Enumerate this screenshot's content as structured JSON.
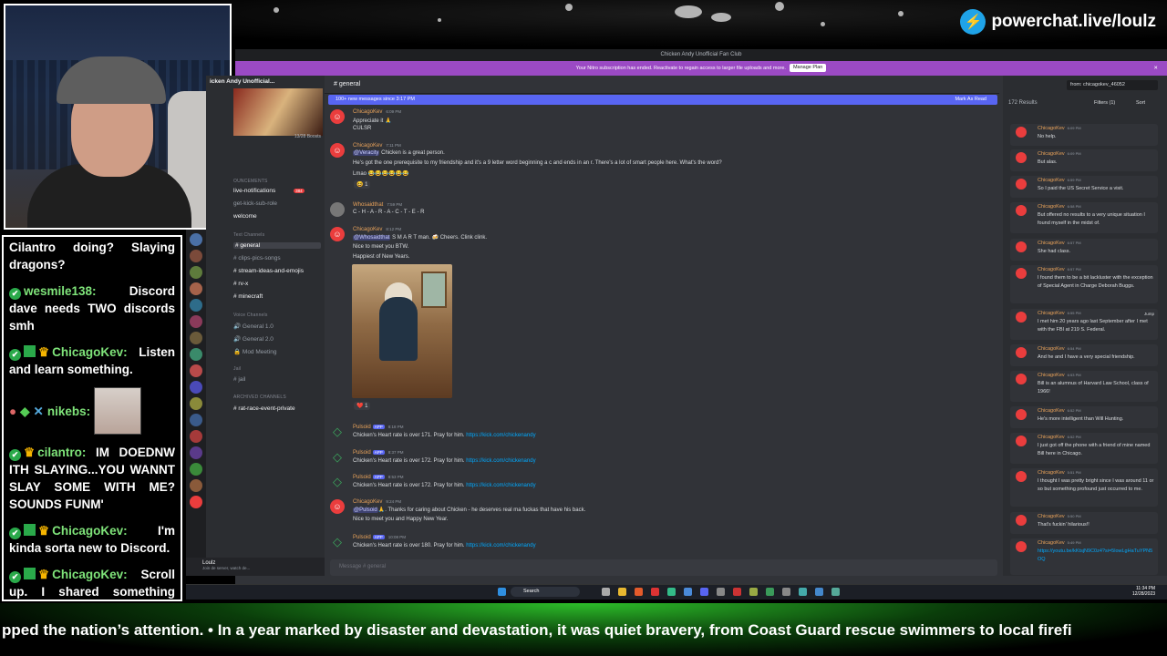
{
  "overlay": {
    "brand": "powerchat.live/loulz",
    "ticker": "pped the nation’s attention.   •   In a year marked by disaster and devastation, it was quiet bravery, from Coast Guard rescue swimmers to local firefi",
    "chat": [
      {
        "user": "",
        "text": "Cilantro doing? Slaying dragons?"
      },
      {
        "user": "wesmile138:",
        "text": "Discord dave needs TWO discords smh"
      },
      {
        "user": "ChicagoKev:",
        "text": "Listen and learn something."
      },
      {
        "user": "nikebs:",
        "text": ""
      },
      {
        "user": "cilantro:",
        "text": "IM DOEDNW ITH SLAYING...YOU WANNT SLAY SOME WITH ME? SOUNDS FUNM'"
      },
      {
        "user": "ChicagoKev:",
        "text": "I'm kinda sorta new to Discord."
      },
      {
        "user": "ChicagoKev:",
        "text": "Scroll up. I shared something valuable. Find the gold"
      }
    ]
  },
  "discord": {
    "window_title": "Chicken Andy Unofficial Fan Club",
    "nitro_notice": "Your Nitro subscription has ended. Reactivate to regain access to larger file uploads and more.",
    "nitro_button": "Manage Plan",
    "server_name": "icken Andy Unofficial...",
    "boosts": "13/28 Boosts",
    "channels": {
      "announcements_cat": "OUNCEMENTS",
      "live_notifications": "live-notifications",
      "live_badge": "384",
      "get_kick": "get-kick-sub-role",
      "welcome": "welcome",
      "text_cat": "Text Channels",
      "general": "general",
      "clips": "clips-pics-songs",
      "stream_ideas": "stream-ideas-and-emojis",
      "rv_x": "rv-x",
      "minecraft": "minecraft",
      "voice_cat": "Voice Channels",
      "general10": "General 1.0",
      "general20": "General 2.0",
      "mod_meeting": "Mod Meeting",
      "jail_cat": "Jail",
      "jail": "jail",
      "archived_cat": "ARCHIVED CHANNELS",
      "rat_race": "rat-race-event-private"
    },
    "user": {
      "name": "Loulz",
      "status": "Join de server, watch de..."
    },
    "channel_name": "general",
    "new_messages": "100+ new messages since 3:17 PM",
    "mark_read": "Mark As Read",
    "messages": [
      {
        "name": "ChicagoKev",
        "ts": "6:09 PM",
        "lines": [
          "Appreciate it 🙏",
          "CULSR"
        ]
      },
      {
        "name": "ChicagoKev",
        "ts": "7:11 PM",
        "mention": "@Veracity",
        "lines": [
          "Chicken is a great person.",
          "He's got the one prerequisite to my friendship and it's a 9 letter word beginning a c and ends in an r. There's a lot of smart people here. What's the word?",
          "Lmao 😂😂😂😂😂😂"
        ]
      },
      {
        "name": "Whosaidthat",
        "ts": "7:59 PM",
        "lines": [
          "C - H - A - R - A - C - T - E - R"
        ]
      },
      {
        "name": "ChicagoKev",
        "ts": "8:12 PM",
        "mention": "@Whosaidthat",
        "lines": [
          "S M A R T man. 🍻 Cheers. Clink clink.",
          "Nice to meet you BTW.",
          "Happiest of New Years."
        ]
      },
      {
        "name": "Pulsoid",
        "app": "APP",
        "ts": "8:18 PM",
        "text": "Chicken's Heart rate is over 171. Pray for him.",
        "link": "https://kick.com/chickenandy"
      },
      {
        "name": "Pulsoid",
        "app": "APP",
        "ts": "8:37 PM",
        "text": "Chicken's Heart rate is over 172. Pray for him.",
        "link": "https://kick.com/chickenandy"
      },
      {
        "name": "Pulsoid",
        "app": "APP",
        "ts": "8:53 PM",
        "text": "Chicken's Heart rate is over 172. Pray for him.",
        "link": "https://kick.com/chickenandy"
      },
      {
        "name": "ChicagoKev",
        "ts": "9:24 PM",
        "mention": "@Pulsoid",
        "lines": [
          "🙏. Thanks for caring about Chicken - he deserves real ma fuckas that have his back.",
          "Nice to meet you and Happy New Year."
        ]
      },
      {
        "name": "Pulsoid",
        "app": "APP",
        "ts": "10:08 PM",
        "text": "Chicken's Heart rate is over 180. Pray for him.",
        "link": "https://kick.com/chickenandy"
      }
    ],
    "reactions": {
      "r1": "😆 1",
      "r2": "❤️ 1"
    },
    "input_placeholder": "Message #   general",
    "search": {
      "query": "from: chicagokev_46052",
      "count": "172 Results",
      "filters": "Filters (1)",
      "sort": "Sort",
      "results": [
        {
          "name": "ChicagoKev",
          "ts": "6:09 PM",
          "text": "No help."
        },
        {
          "name": "ChicagoKev",
          "ts": "6:09 PM",
          "text": "But alas."
        },
        {
          "name": "ChicagoKev",
          "ts": "6:59 PM",
          "text": "So I paid the US Secret Service a visit."
        },
        {
          "name": "ChicagoKev",
          "ts": "6:58 PM",
          "text": "But offered no results to a very unique situation I found myself in the midst of."
        },
        {
          "name": "ChicagoKev",
          "ts": "6:57 PM",
          "text": "She had class."
        },
        {
          "name": "ChicagoKev",
          "ts": "6:57 PM",
          "text": "I found them to be a bit lackluster with the exception of Special Agent in Charge Deborah Buggs."
        },
        {
          "name": "ChicagoKev",
          "ts": "6:55 PM",
          "text": "I met him 20 years ago last September after I met with the FBI at 219 S. Federal."
        },
        {
          "name": "ChicagoKev",
          "ts": "6:54 PM",
          "text": "And he and I have a very special friendship."
        },
        {
          "name": "ChicagoKev",
          "ts": "6:53 PM",
          "text": "Bill is an alumnus of Harvard Law School, class of 1966!"
        },
        {
          "name": "ChicagoKev",
          "ts": "6:52 PM",
          "text": "He's more intelligent than Will Hunting."
        },
        {
          "name": "ChicagoKev",
          "ts": "6:52 PM",
          "text": "I just got off the phone with a friend of mine named Bill here in Chicago."
        },
        {
          "name": "ChicagoKev",
          "ts": "5:51 PM",
          "text": "I thought I was pretty bright since I was around 11 or so but something profound just occurred to me."
        },
        {
          "name": "ChicagoKev",
          "ts": "5:50 PM",
          "text": "That's fuckin' hilarious!!"
        },
        {
          "name": "ChicagoKev",
          "ts": "5:49 PM",
          "text": "https://youtu.be/kKtsjN9C0z4?si=5lowLgHaTuYPN5OQ",
          "is_link": true
        }
      ],
      "jump": "Jump"
    },
    "taskbar": {
      "search": "Search",
      "time": "11:34 PM",
      "date": "12/28/2023"
    }
  },
  "colors": {
    "accent": "#5865f2",
    "nitro": "#9b4ac4",
    "mention_red": "#ea3d3d",
    "name_orange": "#e8a25a",
    "link": "#00a8fc"
  }
}
